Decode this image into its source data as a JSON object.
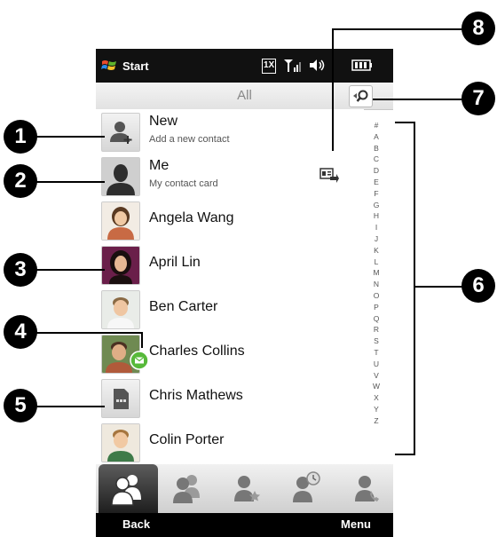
{
  "status_bar": {
    "start_label": "Start",
    "network_label": "1X"
  },
  "filter_bar": {
    "title": "All"
  },
  "contacts": [
    {
      "name": "New",
      "subtitle": "Add a new contact"
    },
    {
      "name": "Me",
      "subtitle": "My contact card"
    },
    {
      "name": "Angela Wang"
    },
    {
      "name": "April Lin"
    },
    {
      "name": "Ben Carter"
    },
    {
      "name": "Charles Collins"
    },
    {
      "name": "Chris Mathews"
    },
    {
      "name": "Colin Porter"
    }
  ],
  "alphabet": [
    "#",
    "A",
    "B",
    "C",
    "D",
    "E",
    "F",
    "G",
    "H",
    "I",
    "J",
    "K",
    "L",
    "M",
    "N",
    "O",
    "P",
    "Q",
    "R",
    "S",
    "T",
    "U",
    "V",
    "W",
    "X",
    "Y",
    "Z"
  ],
  "tabs": [
    "people",
    "groups",
    "favorites",
    "history",
    "calls"
  ],
  "softkeys": {
    "left": "Back",
    "right": "Menu"
  },
  "callouts": [
    "1",
    "2",
    "3",
    "4",
    "5",
    "6",
    "7",
    "8"
  ]
}
